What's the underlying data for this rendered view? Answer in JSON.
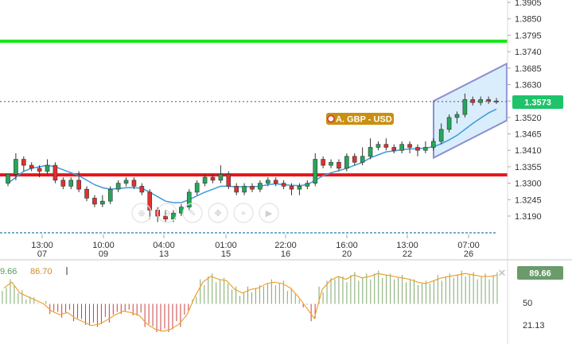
{
  "instrument": {
    "label": "A. GBP - USD"
  },
  "price_axis": {
    "ticks": [
      "1.3905",
      "1.3850",
      "1.3795",
      "1.3740",
      "1.3685",
      "1.3630",
      "1.3575",
      "1.3520",
      "1.3465",
      "1.3410",
      "1.3355",
      "1.3300",
      "1.3245",
      "1.3190"
    ],
    "current_price": "1.3573"
  },
  "time_axis": [
    {
      "time": "13:00",
      "day": "07"
    },
    {
      "time": "10:00",
      "day": "09"
    },
    {
      "time": "04:00",
      "day": "13"
    },
    {
      "time": "01:00",
      "day": "15"
    },
    {
      "time": "22:00",
      "day": "16"
    },
    {
      "time": "16:00",
      "day": "20"
    },
    {
      "time": "13:00",
      "day": "22"
    },
    {
      "time": "07:00",
      "day": "26"
    }
  ],
  "indicator": {
    "value_a": "9.66",
    "value_b": "86.70",
    "current_value": "89.66",
    "ticks": [
      "50",
      "21.13"
    ]
  },
  "colors": {
    "up": "#26a65b",
    "down": "#e03030",
    "support_line": "#e8141b",
    "resistance_line": "#19e619",
    "channel_stroke": "#8a8fd0",
    "channel_fill": "#cfe9fb",
    "ma_line": "#3f9ad8",
    "oscillator_line": "#f0a030",
    "price_badge": "#1ec36a",
    "instrument_badge": "#c9900f"
  },
  "toolbar_icons": [
    "zoom-in-icon",
    "zoom-out-icon",
    "drawing-tool-icon",
    "pan-icon",
    "crosshair-icon",
    "play-icon"
  ],
  "chart_data": {
    "type": "candlestick",
    "resistance_level": 1.3775,
    "support_level": 1.3328,
    "channel": {
      "upper": [
        1.3575,
        1.37
      ],
      "lower": [
        1.3385,
        1.351
      ]
    },
    "candles": [
      [
        1.33,
        1.333,
        1.332,
        1.329
      ],
      [
        1.333,
        1.338,
        1.34,
        1.331
      ],
      [
        1.338,
        1.336,
        1.339,
        1.334
      ],
      [
        1.336,
        1.335,
        1.337,
        1.334
      ],
      [
        1.335,
        1.334,
        1.336,
        1.332
      ],
      [
        1.334,
        1.336,
        1.338,
        1.333
      ],
      [
        1.336,
        1.331,
        1.337,
        1.33
      ],
      [
        1.331,
        1.329,
        1.332,
        1.328
      ],
      [
        1.329,
        1.331,
        1.332,
        1.328
      ],
      [
        1.331,
        1.328,
        1.334,
        1.327
      ],
      [
        1.328,
        1.325,
        1.329,
        1.324
      ],
      [
        1.325,
        1.323,
        1.326,
        1.322
      ],
      [
        1.323,
        1.324,
        1.326,
        1.322
      ],
      [
        1.324,
        1.328,
        1.329,
        1.323
      ],
      [
        1.328,
        1.33,
        1.331,
        1.327
      ],
      [
        1.33,
        1.331,
        1.332,
        1.329
      ],
      [
        1.331,
        1.329,
        1.332,
        1.328
      ],
      [
        1.329,
        1.327,
        1.33,
        1.326
      ],
      [
        1.327,
        1.321,
        1.328,
        1.318
      ],
      [
        1.321,
        1.319,
        1.322,
        1.317
      ],
      [
        1.319,
        1.318,
        1.321,
        1.317
      ],
      [
        1.318,
        1.32,
        1.321,
        1.317
      ],
      [
        1.32,
        1.322,
        1.323,
        1.319
      ],
      [
        1.322,
        1.327,
        1.328,
        1.321
      ],
      [
        1.327,
        1.33,
        1.331,
        1.326
      ],
      [
        1.33,
        1.332,
        1.333,
        1.329
      ],
      [
        1.332,
        1.331,
        1.333,
        1.33
      ],
      [
        1.331,
        1.333,
        1.336,
        1.33
      ],
      [
        1.333,
        1.329,
        1.334,
        1.328
      ],
      [
        1.329,
        1.327,
        1.33,
        1.326
      ],
      [
        1.327,
        1.329,
        1.33,
        1.326
      ],
      [
        1.329,
        1.328,
        1.33,
        1.327
      ],
      [
        1.328,
        1.33,
        1.331,
        1.327
      ],
      [
        1.33,
        1.331,
        1.332,
        1.329
      ],
      [
        1.331,
        1.33,
        1.332,
        1.329
      ],
      [
        1.33,
        1.329,
        1.331,
        1.328
      ],
      [
        1.329,
        1.328,
        1.33,
        1.326
      ],
      [
        1.328,
        1.329,
        1.33,
        1.326
      ],
      [
        1.329,
        1.33,
        1.331,
        1.328
      ],
      [
        1.33,
        1.338,
        1.34,
        1.329
      ],
      [
        1.338,
        1.336,
        1.339,
        1.335
      ],
      [
        1.336,
        1.337,
        1.338,
        1.335
      ],
      [
        1.337,
        1.335,
        1.338,
        1.334
      ],
      [
        1.335,
        1.339,
        1.34,
        1.334
      ],
      [
        1.339,
        1.337,
        1.34,
        1.336
      ],
      [
        1.337,
        1.339,
        1.342,
        1.336
      ],
      [
        1.339,
        1.342,
        1.345,
        1.338
      ],
      [
        1.342,
        1.343,
        1.344,
        1.341
      ],
      [
        1.343,
        1.342,
        1.345,
        1.341
      ],
      [
        1.342,
        1.341,
        1.343,
        1.34
      ],
      [
        1.341,
        1.343,
        1.344,
        1.34
      ],
      [
        1.343,
        1.342,
        1.344,
        1.34
      ],
      [
        1.342,
        1.341,
        1.343,
        1.339
      ],
      [
        1.341,
        1.342,
        1.344,
        1.34
      ],
      [
        1.342,
        1.344,
        1.345,
        1.341
      ],
      [
        1.344,
        1.348,
        1.35,
        1.343
      ],
      [
        1.348,
        1.352,
        1.353,
        1.347
      ],
      [
        1.352,
        1.353,
        1.354,
        1.35
      ],
      [
        1.353,
        1.358,
        1.36,
        1.352
      ],
      [
        1.358,
        1.357,
        1.359,
        1.356
      ],
      [
        1.357,
        1.358,
        1.359,
        1.356
      ],
      [
        1.358,
        1.3575,
        1.359,
        1.3565
      ],
      [
        1.3575,
        1.3573,
        1.3585,
        1.3565
      ]
    ],
    "ma": [
      1.33,
      1.332,
      1.334,
      1.335,
      1.3355,
      1.336,
      1.3355,
      1.3345,
      1.3335,
      1.3325,
      1.331,
      1.3295,
      1.3285,
      1.328,
      1.3282,
      1.3285,
      1.3285,
      1.3283,
      1.327,
      1.3255,
      1.324,
      1.3235,
      1.3235,
      1.3245,
      1.3258,
      1.327,
      1.328,
      1.329,
      1.329,
      1.3288,
      1.3288,
      1.3288,
      1.329,
      1.3295,
      1.3298,
      1.3295,
      1.3293,
      1.3292,
      1.3295,
      1.331,
      1.3325,
      1.3335,
      1.3342,
      1.335,
      1.336,
      1.337,
      1.3385,
      1.3395,
      1.3405,
      1.3408,
      1.3412,
      1.3415,
      1.3415,
      1.3418,
      1.3422,
      1.3432,
      1.3445,
      1.346,
      1.348,
      1.35,
      1.3518,
      1.3535,
      1.3548
    ],
    "oscillator": [
      72,
      80,
      65,
      60,
      55,
      50,
      40,
      35,
      38,
      30,
      25,
      20,
      22,
      28,
      35,
      40,
      38,
      34,
      22,
      15,
      12,
      15,
      22,
      35,
      60,
      80,
      88,
      84,
      82,
      70,
      65,
      70,
      72,
      78,
      80,
      78,
      72,
      60,
      45,
      30,
      70,
      82,
      88,
      84,
      90,
      86,
      88,
      92,
      90,
      88,
      86,
      84,
      80,
      78,
      82,
      86,
      88,
      90,
      92,
      90,
      88,
      88,
      89.66
    ],
    "indicator_ticks": [
      50,
      21.13
    ]
  }
}
